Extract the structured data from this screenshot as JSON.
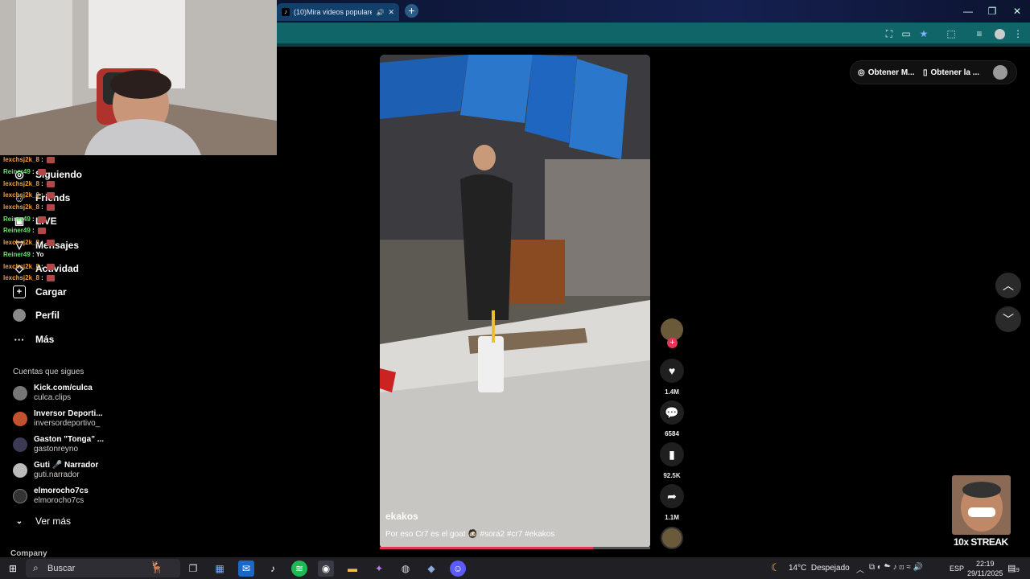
{
  "browser": {
    "tab_title": "(10)Mira videos populares",
    "new_tab": "+",
    "window_controls": [
      "—",
      "❐",
      "✕"
    ]
  },
  "sidebar": {
    "nav": [
      {
        "label": "Siguiendo",
        "icon": "following-icon"
      },
      {
        "label": "Friends",
        "icon": "friends-icon"
      },
      {
        "label": "LIVE",
        "icon": "live-icon"
      },
      {
        "label": "Mensajes",
        "icon": "messages-icon"
      },
      {
        "label": "Actividad",
        "icon": "activity-icon"
      },
      {
        "label": "Cargar",
        "icon": "upload-icon"
      },
      {
        "label": "Perfil",
        "icon": "profile-icon"
      },
      {
        "label": "Más",
        "icon": "more-icon"
      }
    ],
    "following_title": "Cuentas que sigues",
    "accounts": [
      {
        "name": "Kick.com/culca",
        "handle": "culca.clips"
      },
      {
        "name": "Inversor Deporti...",
        "handle": "inversordeportivo_"
      },
      {
        "name": "Gaston \"Tonga\" ...",
        "handle": "gastonreyno"
      },
      {
        "name": "Guti 🎤 Narrador",
        "handle": "guti.narrador"
      },
      {
        "name": "elmorocho7cs",
        "handle": "elmorocho7cs"
      }
    ],
    "see_more": "Ver más",
    "company": "Company"
  },
  "chat": [
    {
      "user": "lexchsj2k_8",
      "msg": "",
      "kind": "u1"
    },
    {
      "user": "Reiner49",
      "msg": "",
      "kind": "u2"
    },
    {
      "user": "lexchsj2k_8",
      "msg": "",
      "kind": "u1"
    },
    {
      "user": "lexchsj2k_8",
      "msg": "",
      "kind": "u1"
    },
    {
      "user": "lexchsj2k_8",
      "msg": "",
      "kind": "u1"
    },
    {
      "user": "Reiner49",
      "msg": "",
      "kind": "u2"
    },
    {
      "user": "Reiner49",
      "msg": "",
      "kind": "u2"
    },
    {
      "user": "lexchsj2k_8",
      "msg": "",
      "kind": "u1"
    },
    {
      "user": "Reiner49",
      "msg": "Yo",
      "kind": "u2"
    },
    {
      "user": "lexchsj2k_8",
      "msg": "",
      "kind": "u1"
    },
    {
      "user": "lexchsj2k_8",
      "msg": "",
      "kind": "u1"
    }
  ],
  "video": {
    "author": "ekakos",
    "caption": "Por eso Cr7 es el goat 🧔🏻 #sora2 #cr7 #ekakos",
    "progress": 0.79,
    "likes": "1.4M",
    "comments": "6584",
    "saves": "92.5K",
    "shares": "1.1M"
  },
  "topbar": {
    "get_coins": "Obtener M...",
    "get_app": "Obtener la ..."
  },
  "overlay": {
    "streak": "10x STREAK"
  },
  "taskbar": {
    "search_placeholder": "Buscar",
    "weather": "14°C  Despejado",
    "lang": "ESP",
    "time": "22:19",
    "date": "29/11/2025",
    "notif_count": "19"
  }
}
